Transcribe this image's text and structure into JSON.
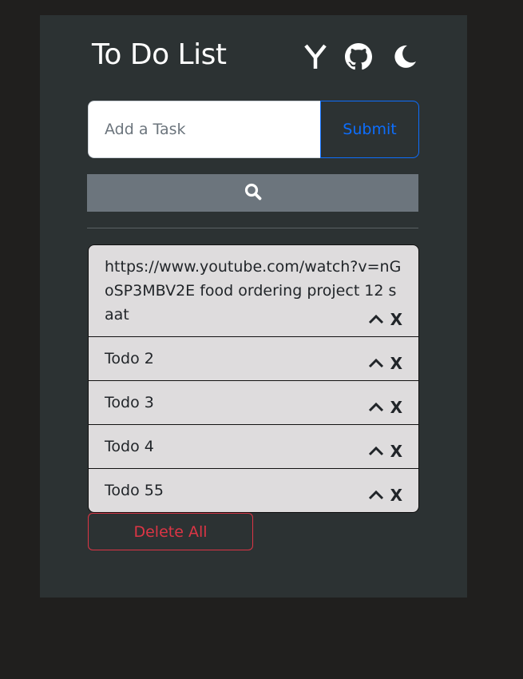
{
  "app": {
    "title": "To Do List"
  },
  "header_icons": [
    {
      "name": "ycombinator-icon",
      "glyph": "Y"
    },
    {
      "name": "github-icon"
    },
    {
      "name": "moon-icon"
    }
  ],
  "form": {
    "placeholder": "Add a Task",
    "value": "",
    "submit_label": "Submit"
  },
  "search": {
    "icon": "search-icon"
  },
  "todos": [
    {
      "text": "https://www.youtube.com/watch?v=nGoSP3MBV2E food ordering project 12 saat"
    },
    {
      "text": "Todo 2"
    },
    {
      "text": "Todo 3"
    },
    {
      "text": "Todo 4"
    },
    {
      "text": "Todo 55"
    }
  ],
  "todo_actions": {
    "delete_label": "X",
    "move_up_icon": "chevron-up-icon"
  },
  "footer": {
    "delete_all_label": "Delete All"
  },
  "colors": {
    "page_bg": "#201f1e",
    "panel_bg": "#2c3233",
    "submit_accent": "#0d6efd",
    "danger": "#dc3545",
    "search_bar_bg": "#6c757d",
    "item_bg": "#dedcdd"
  }
}
